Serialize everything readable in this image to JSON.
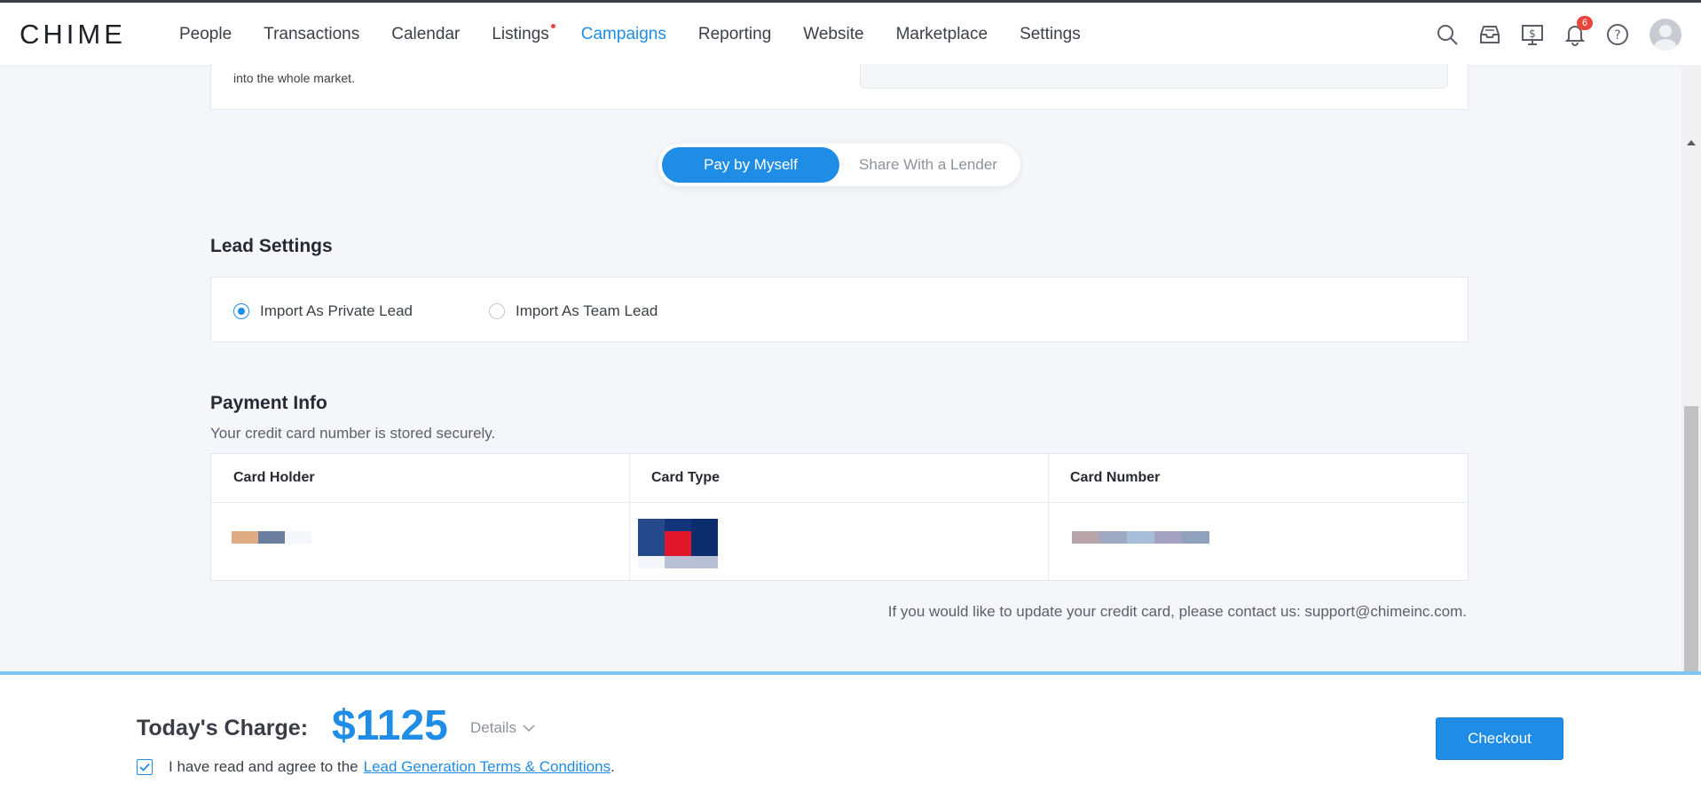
{
  "nav": {
    "logo": "CHIME",
    "items": [
      {
        "label": "People"
      },
      {
        "label": "Transactions"
      },
      {
        "label": "Calendar"
      },
      {
        "label": "Listings"
      },
      {
        "label": "Campaigns"
      },
      {
        "label": "Reporting"
      },
      {
        "label": "Website"
      },
      {
        "label": "Marketplace"
      },
      {
        "label": "Settings"
      }
    ],
    "active": "Campaigns",
    "notification_count": "6",
    "icons": [
      "search-icon",
      "inbox-icon",
      "billing-icon",
      "bell-icon",
      "help-icon",
      "avatar"
    ]
  },
  "prev_card": {
    "text": "into the whole market."
  },
  "payment_toggle": {
    "selected": "Pay by Myself",
    "option_1": "Pay by Myself",
    "option_2": "Share With a Lender"
  },
  "lead_settings": {
    "title": "Lead Settings",
    "private_label": "Import As Private Lead",
    "team_label": "Import As Team Lead",
    "selected": "Import As Private Lead"
  },
  "payment_info": {
    "title": "Payment Info",
    "subtitle": "Your credit card number is stored securely.",
    "columns": [
      "Card Holder",
      "Card Type",
      "Card Number"
    ],
    "contact_text": "If you would like to update your credit card, please contact us: support@chimeinc.com."
  },
  "footer": {
    "charge_label": "Today's Charge:",
    "charge_amount": "$1125",
    "details_label": "Details",
    "agree_text": "I have read and agree to the",
    "terms_link": "Lead Generation Terms & Conditions",
    "agree_suffix": ".",
    "agreed": true,
    "checkout_label": "Checkout"
  },
  "colors": {
    "accent": "#1f8ce6",
    "badge": "#e8453c",
    "footer_border": "#7cc6f4"
  }
}
